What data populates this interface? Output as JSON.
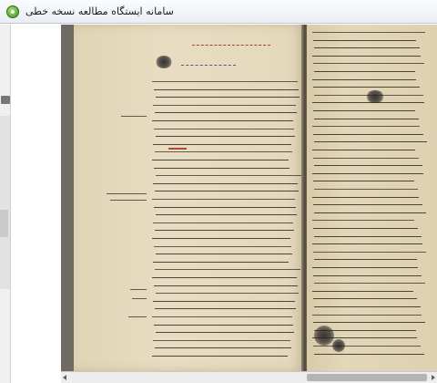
{
  "window": {
    "title": "سامانه ایستگاه مطالعه نسخه خطی",
    "icon": "app-logo-icon"
  },
  "viewer": {
    "content": "manuscript-spread",
    "colors": {
      "paper": "#e5d9bc",
      "ink": "#2a2520",
      "rubric": "#b23a2a",
      "background": "#6f6b64"
    }
  }
}
